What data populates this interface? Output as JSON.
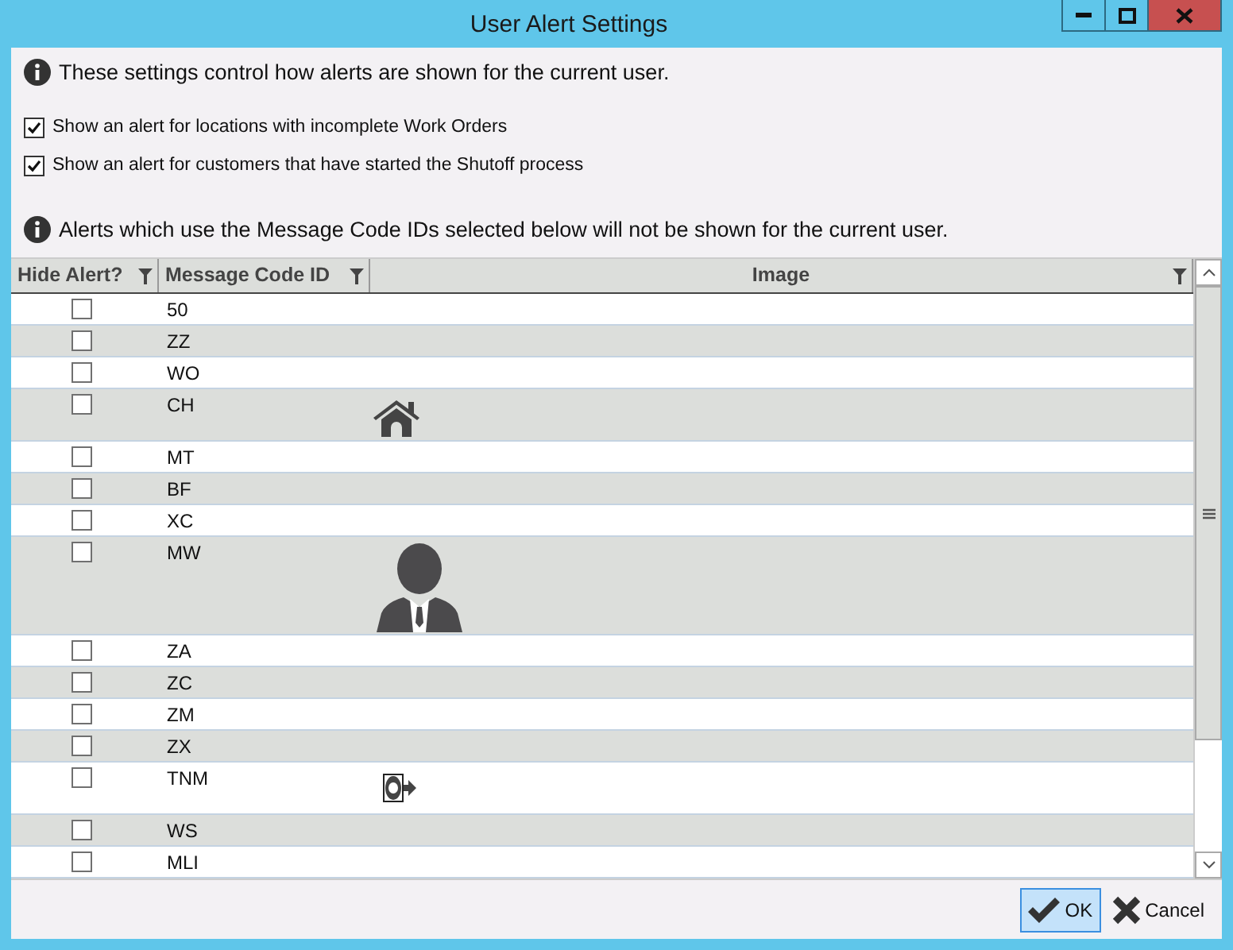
{
  "window": {
    "title": "User Alert Settings"
  },
  "intro": "These settings control how alerts are shown for the current user.",
  "options": [
    {
      "label": "Show an alert for locations with incomplete Work Orders",
      "checked": true
    },
    {
      "label": "Show an alert for customers that have started the Shutoff process",
      "checked": true
    }
  ],
  "grid_note": "Alerts which use the Message Code IDs selected below will not be shown for the current user.",
  "table": {
    "columns": [
      "Hide Alert?",
      "Message Code ID",
      "Image"
    ],
    "rows": [
      {
        "code": "50",
        "checked": false,
        "kind": "plain"
      },
      {
        "code": "ZZ",
        "checked": false,
        "kind": "plain"
      },
      {
        "code": "WO",
        "checked": false,
        "kind": "plain"
      },
      {
        "code": "CH",
        "checked": false,
        "kind": "house"
      },
      {
        "code": "MT",
        "checked": false,
        "kind": "plain"
      },
      {
        "code": "BF",
        "checked": false,
        "kind": "plain"
      },
      {
        "code": "XC",
        "checked": false,
        "kind": "plain"
      },
      {
        "code": "MW",
        "checked": false,
        "kind": "person"
      },
      {
        "code": "ZA",
        "checked": false,
        "kind": "plain"
      },
      {
        "code": "ZC",
        "checked": false,
        "kind": "plain"
      },
      {
        "code": "ZM",
        "checked": false,
        "kind": "plain"
      },
      {
        "code": "ZX",
        "checked": false,
        "kind": "plain"
      },
      {
        "code": "TNM",
        "checked": false,
        "kind": "meter"
      },
      {
        "code": "WS",
        "checked": false,
        "kind": "plain"
      },
      {
        "code": "MLI",
        "checked": false,
        "kind": "plain"
      }
    ]
  },
  "buttons": [
    {
      "label": "OK",
      "kind": "ok",
      "selected": true
    },
    {
      "label": "Cancel",
      "kind": "cancel",
      "selected": false
    }
  ]
}
